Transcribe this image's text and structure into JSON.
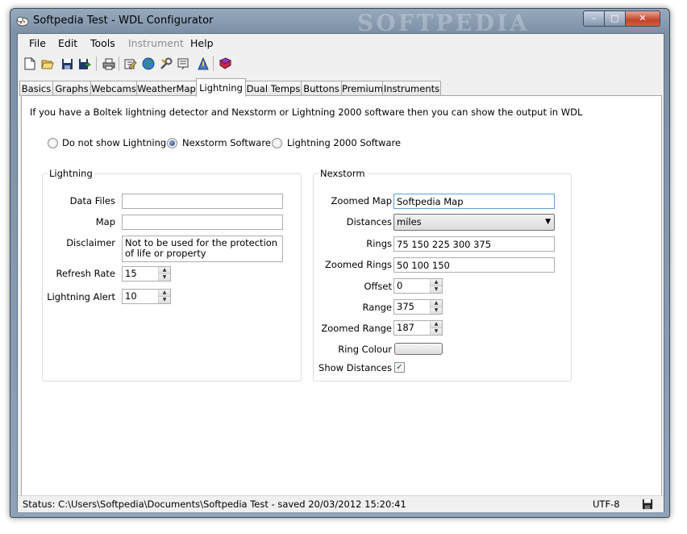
{
  "window": {
    "title": "Softpedia Test - WDL Configurator",
    "watermark": "SOFTPEDIA",
    "min_glyph": "–",
    "max_glyph": "□",
    "close_glyph": "✕"
  },
  "menu": [
    "File",
    "Edit",
    "Tools",
    "Instrument",
    "Help"
  ],
  "menu_disabled": "Instrument",
  "toolbar_icons": [
    "new-file-icon",
    "open-folder-icon",
    "save-icon",
    "save-as-icon",
    "print-icon",
    "edit-icon",
    "web-icon",
    "tools-icon",
    "preview-icon",
    "instrument-icon",
    "book-icon"
  ],
  "tabs": [
    "Basics",
    "Graphs",
    "Webcams",
    "WeatherMap",
    "Lightning",
    "Dual Temps",
    "Buttons",
    "Premium",
    "Instruments"
  ],
  "active_tab": "Lightning",
  "lightning": {
    "intro": "If you have a Boltek lightning detector and Nexstorm or Lightning 2000 software then you can show the output in WDL",
    "radios": [
      {
        "label": "Do not show Lightning",
        "selected": false
      },
      {
        "label": "Nexstorm Software",
        "selected": true
      },
      {
        "label": "Lightning 2000 Software",
        "selected": false
      }
    ],
    "group_left": {
      "title": "Lightning",
      "data_files_label": "Data Files",
      "data_files_value": "",
      "map_label": "Map",
      "map_value": "",
      "disclaimer_label": "Disclaimer",
      "disclaimer_value": "Not to be used for the protection of life or property",
      "refresh_rate_label": "Refresh Rate",
      "refresh_rate_value": "15",
      "alert_label": "Lightning Alert",
      "alert_value": "10"
    },
    "group_right": {
      "title": "Nexstorm",
      "zoomed_map_label": "Zoomed Map",
      "zoomed_map_value": "Softpedia Map",
      "distances_label": "Distances",
      "distances_value": "miles",
      "rings_label": "Rings",
      "rings_value": "75 150 225 300 375",
      "zoomed_rings_label": "Zoomed Rings",
      "zoomed_rings_value": "50 100 150",
      "offset_label": "Offset",
      "offset_value": "0",
      "range_label": "Range",
      "range_value": "375",
      "zoomed_range_label": "Zoomed Range",
      "zoomed_range_value": "187",
      "ring_colour_label": "Ring Colour",
      "show_distances_label": "Show Distances",
      "show_distances_checked": true
    }
  },
  "status": {
    "text": "Status: C:\\Users\\Softpedia\\Documents\\Softpedia Test - saved 20/03/2012 15:20:41",
    "encoding": "UTF-8"
  },
  "glyphs": {
    "check": "✓",
    "up": "▲",
    "down": "▼"
  }
}
